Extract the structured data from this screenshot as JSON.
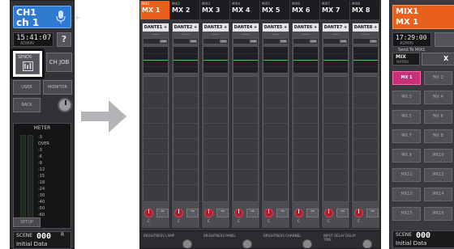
{
  "left_panel": {
    "channel_num": "CH1",
    "channel_name": "ch 1",
    "plus": "+",
    "time": "15:41:07",
    "access": "ADMIN",
    "help": "?",
    "sends_label": "SENDS",
    "ch_job": "CH JOB",
    "user_defined": "USER DEFINED",
    "monitor": "MONITOR",
    "rack": "RACK",
    "meter_title": "METER",
    "meter_scale": [
      "-3",
      "OVER",
      "-3",
      "-6",
      "-9",
      "-12",
      "-15",
      "-18",
      "-24",
      "-30",
      "-40",
      "-50",
      "-60"
    ],
    "meter_lr": "L  R",
    "setup": "SETUP",
    "scene_label": "SCENE",
    "scene_number": "000",
    "scene_r": "R",
    "scene_title": "Initial Data"
  },
  "main_panel": {
    "mx_strip": [
      {
        "key": "MIX1",
        "name": "MX 1"
      },
      {
        "key": "MIX2",
        "name": "MX 2"
      },
      {
        "key": "MIX3",
        "name": "MX 3"
      },
      {
        "key": "MIX4",
        "name": "MX 4"
      },
      {
        "key": "MIX5",
        "name": "MX 5"
      },
      {
        "key": "MIX6",
        "name": "MX 6"
      },
      {
        "key": "MIX7",
        "name": "MX 7"
      },
      {
        "key": "MIX8",
        "name": "MX 8"
      }
    ],
    "columns": [
      "DANTE1 +",
      "DANTE2 +",
      "DANTE3 +",
      "DANTE4 +",
      "DANTE5 +",
      "DANTE6 +",
      "DANTE7 +",
      "DANTE8 +"
    ],
    "dash": "-----",
    "pt_label": "1MS",
    "knob_label": "C",
    "on_label": "ON",
    "bottom_labels": [
      "BRIGHTNESS LAMP",
      "BRIGHTNESS PANEL",
      "BRIGHTNESS CHANNEL",
      "INPUT DELAY DELAY TIME"
    ]
  },
  "right_panel": {
    "header_line1": "MIX1",
    "header_line2": "MX 1",
    "time": "17:29:00",
    "access": "ADMIN",
    "send_to": "Send To MIX1",
    "tab_label": "MIX",
    "tab_sub": "MATRIX",
    "x_button": "X",
    "mx_buttons": [
      [
        "MX 1",
        "MX 2"
      ],
      [
        "MX 3",
        "MX 4"
      ],
      [
        "MX 5",
        "MX 6"
      ],
      [
        "MX 7",
        "MX 8"
      ],
      [
        "MX 9",
        "MX10"
      ],
      [
        "MX11",
        "MX12"
      ],
      [
        "MX13",
        "MX14"
      ],
      [
        "MX15",
        "MX16"
      ]
    ],
    "scene_label": "SCENE",
    "scene_number": "000",
    "scene_title": "Initial Data"
  },
  "colors": {
    "selected_mix": "#e8601c",
    "selected_button": "#c8307a",
    "channel_blue": "#2f7bd1",
    "panel_dark": "#3a3a3e"
  }
}
